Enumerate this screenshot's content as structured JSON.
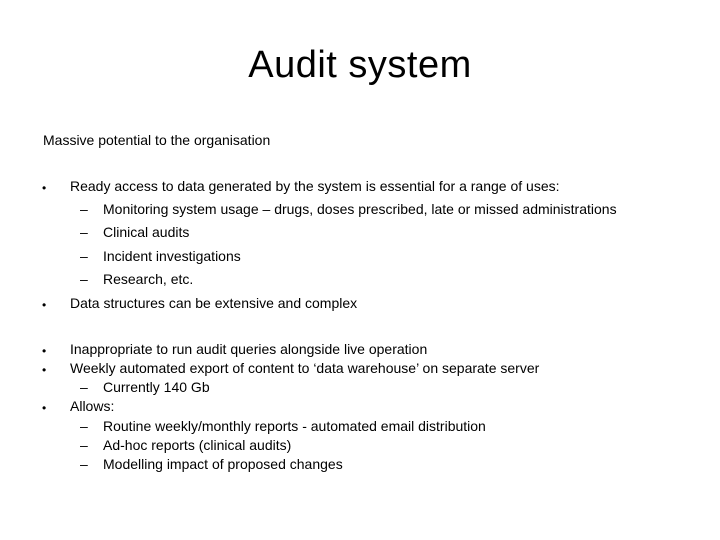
{
  "slide": {
    "title": "Audit system",
    "intro": "Massive potential to the organisation",
    "group1": {
      "bullets": [
        {
          "text": "Ready access to data generated by the system is essential for a range of uses:",
          "subitems": [
            "Monitoring system usage – drugs, doses prescribed, late or missed administrations",
            "Clinical audits",
            "Incident investigations",
            "Research, etc."
          ]
        },
        {
          "text": "Data structures can be extensive and complex"
        }
      ]
    },
    "group2": {
      "bullets": [
        {
          "text": "Inappropriate to run audit queries alongside live operation"
        },
        {
          "text": "Weekly automated export of content to ‘data warehouse’ on separate server",
          "subitems": [
            "Currently 140 Gb"
          ]
        },
        {
          "text": "Allows:",
          "subitems": [
            "Routine weekly/monthly reports - automated email distribution",
            "Ad-hoc reports (clinical audits)",
            "Modelling impact of proposed changes"
          ]
        }
      ]
    },
    "bullet_glyph": "•",
    "dash_glyph": "–"
  }
}
